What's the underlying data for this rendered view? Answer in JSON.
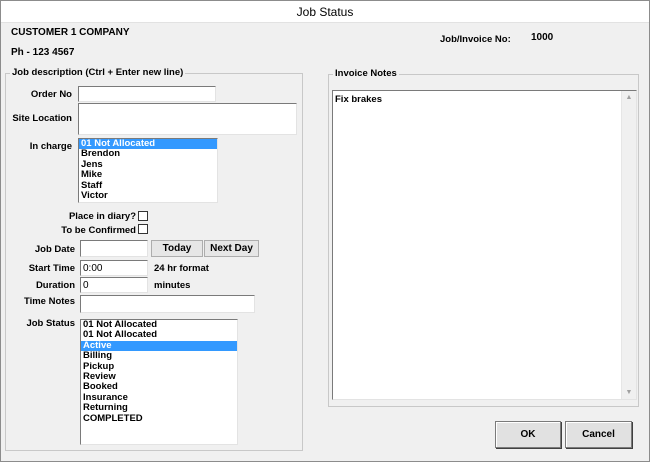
{
  "window": {
    "title": "Job Status"
  },
  "customer": {
    "name": "CUSTOMER 1 COMPANY",
    "phone": "Ph  - 123 4567"
  },
  "invoice": {
    "label": "Job/Invoice No:",
    "value": "1000"
  },
  "job_group": {
    "legend": "Job description (Ctrl + Enter new line)"
  },
  "fields": {
    "order_no": {
      "label": "Order No",
      "value": ""
    },
    "site_location": {
      "label": "Site Location",
      "value": ""
    },
    "in_charge": {
      "label": "In charge",
      "options": [
        "01 Not Allocated",
        "Brendon",
        "Jens",
        "Mike",
        "Staff",
        "Victor"
      ],
      "selected_index": 0
    },
    "place_in_diary": {
      "label": "Place in diary?",
      "checked": false
    },
    "to_be_confirmed": {
      "label": "To be Confirmed",
      "checked": false
    },
    "job_date": {
      "label": "Job Date",
      "value": ""
    },
    "start_time": {
      "label": "Start Time",
      "value": "0:00",
      "hint": "24 hr format"
    },
    "duration": {
      "label": "Duration",
      "value": "0",
      "unit": "minutes"
    },
    "time_notes": {
      "label": "Time Notes",
      "value": ""
    },
    "job_status": {
      "label": "Job Status",
      "options": [
        "01 Not Allocated",
        "01 Not Allocated",
        "Active",
        "Billing",
        "Pickup",
        "Review",
        "Booked",
        "Insurance",
        "Returning",
        "COMPLETED"
      ],
      "selected_index": 2
    }
  },
  "buttons": {
    "today": "Today",
    "next_day": "Next Day",
    "ok": "OK",
    "cancel": "Cancel"
  },
  "invoice_notes": {
    "legend": "Invoice Notes",
    "text": "Fix brakes"
  },
  "colors": {
    "selection": "#3399ff",
    "background": "#f0f0f0"
  }
}
